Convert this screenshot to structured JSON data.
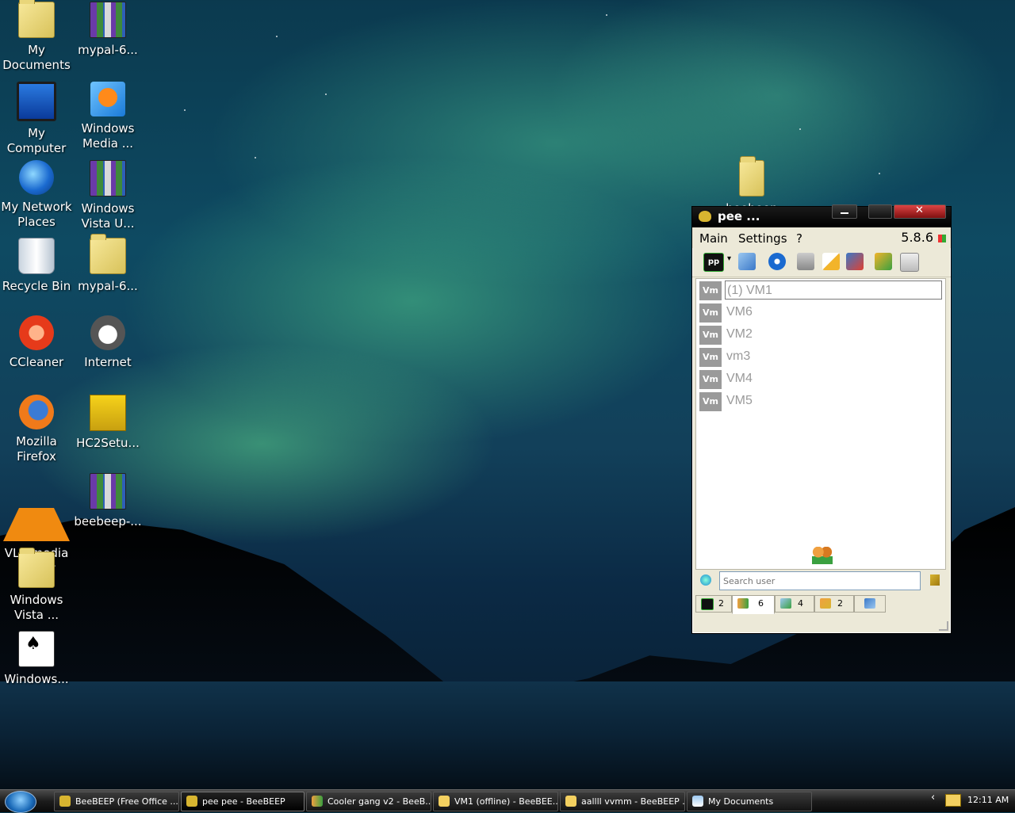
{
  "desktop": {
    "icons": [
      {
        "label": "My Documents"
      },
      {
        "label": "mypal-6..."
      },
      {
        "label": "My Computer"
      },
      {
        "label": "Windows Media ..."
      },
      {
        "label": "My Network Places"
      },
      {
        "label": "Windows Vista U..."
      },
      {
        "label": "Recycle Bin"
      },
      {
        "label": "mypal-6..."
      },
      {
        "label": "CCleaner"
      },
      {
        "label": "Internet"
      },
      {
        "label": "Mozilla Firefox"
      },
      {
        "label": "HC2Setu..."
      },
      {
        "label": "VLC media player"
      },
      {
        "label": "beebeep-..."
      },
      {
        "label": "Windows Vista ..."
      },
      {
        "label": "Windows..."
      },
      {
        "label": "beebeep"
      }
    ]
  },
  "window": {
    "title": "pee ...",
    "menu": {
      "main": "Main",
      "settings": "Settings",
      "help": "?"
    },
    "version": "5.8.6",
    "toolbar": {
      "profile_badge": "pp"
    },
    "users": [
      {
        "badge": "Vm",
        "name": "(1) VM1"
      },
      {
        "badge": "Vm",
        "name": "VM6"
      },
      {
        "badge": "Vm",
        "name": "VM2"
      },
      {
        "badge": "Vm",
        "name": "vm3"
      },
      {
        "badge": "Vm",
        "name": "VM4"
      },
      {
        "badge": "Vm",
        "name": "VM5"
      }
    ],
    "search": {
      "placeholder": "Search user"
    },
    "tabs": [
      {
        "count": "2"
      },
      {
        "count": "6"
      },
      {
        "count": "4"
      },
      {
        "count": "2"
      },
      {
        "count": ""
      }
    ]
  },
  "taskbar": {
    "items": [
      {
        "label": "BeeBEEP (Free Office ..."
      },
      {
        "label": "pee pee - BeeBEEP"
      },
      {
        "label": "Cooler gang v2 - BeeB..."
      },
      {
        "label": "VM1 (offline) - BeeBEE..."
      },
      {
        "label": "aallll vvmm - BeeBEEP ..."
      },
      {
        "label": "My Documents"
      }
    ],
    "clock": "12:11 AM"
  },
  "colors": {
    "accent": "#1a6ab8",
    "user_badge": "#9a9a9a",
    "window_bg": "#ece9d8"
  }
}
